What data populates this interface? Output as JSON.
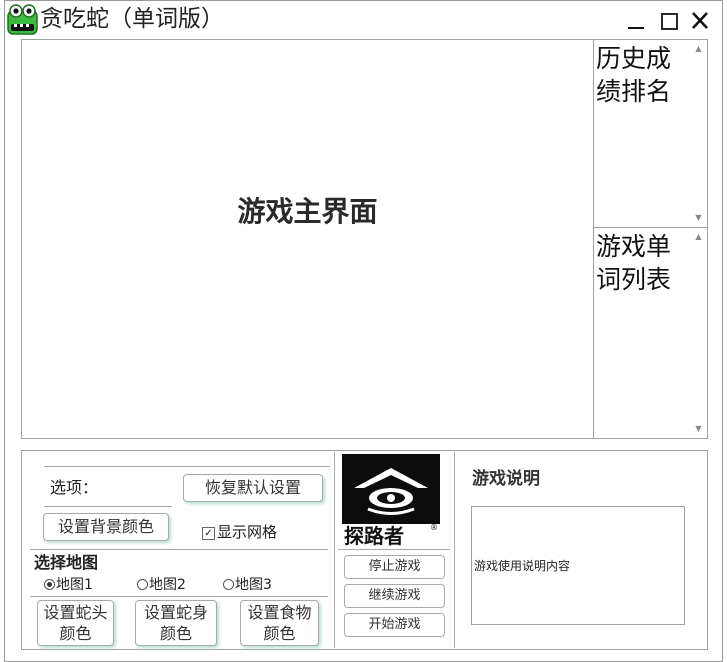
{
  "window": {
    "title": "贪吃蛇（单词版）",
    "icon": "snake-app-icon",
    "controls": {
      "minimize": "—",
      "maximize": "☐",
      "close": "✕"
    }
  },
  "game_area": {
    "label": "游戏主界面"
  },
  "history_list": {
    "text": "历史成绩排名"
  },
  "word_list": {
    "text": "游戏单词列表"
  },
  "scroll_arrows": {
    "up": "▲",
    "down": "▼"
  },
  "options": {
    "label": "选项：",
    "reset_button": "恢复默认设置",
    "bg_color_button": "设置背景颜色",
    "grid_checkbox": {
      "label": "显示网格",
      "checked": true,
      "mark": "☑"
    },
    "map_title": "选择地图",
    "maps": [
      {
        "label": "地图1",
        "selected": true
      },
      {
        "label": "地图2",
        "selected": false
      },
      {
        "label": "地图3",
        "selected": false
      }
    ],
    "head_color_button": {
      "line1": "设置蛇头",
      "line2": "颜色"
    },
    "body_color_button": {
      "line1": "设置蛇身",
      "line2": "颜色"
    },
    "food_color_button": {
      "line1": "设置食物",
      "line2": "颜色"
    }
  },
  "logo": {
    "text": "探路者",
    "registered": "®"
  },
  "controls": {
    "stop": "停止游戏",
    "continue": "继续游戏",
    "start": "开始游戏"
  },
  "help": {
    "title": "游戏说明",
    "content": "游戏使用说明内容"
  },
  "colors": {
    "button_shadow": "#b9dcd8",
    "border": "#a0a0a0",
    "snake_icon_green": "#3dbb3d"
  }
}
